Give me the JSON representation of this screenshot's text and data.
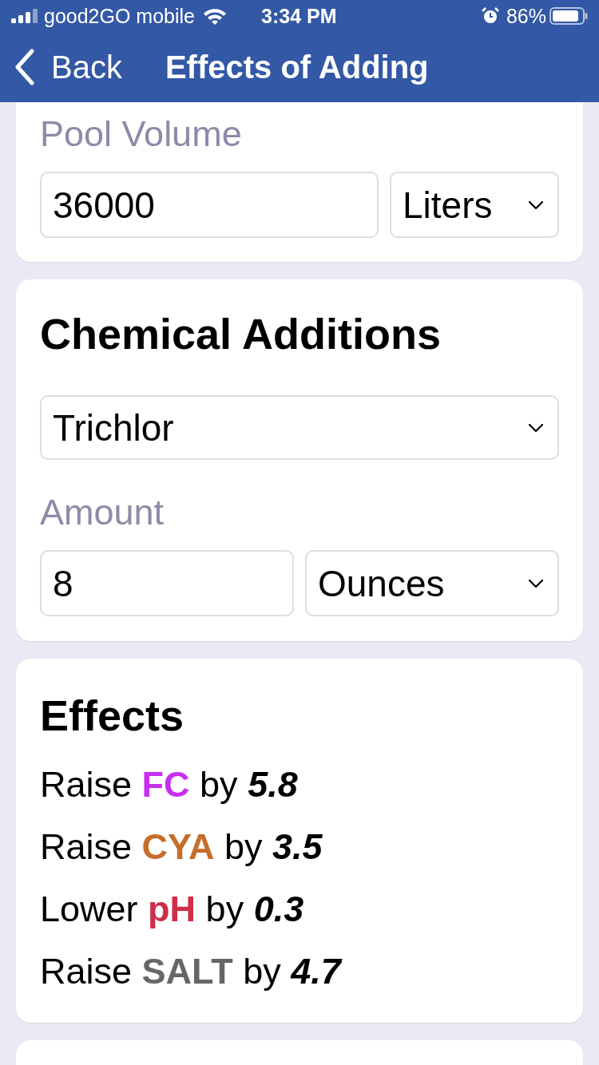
{
  "status_bar": {
    "carrier": "good2GO mobile",
    "time": "3:34 PM",
    "battery": "86%"
  },
  "nav_bar": {
    "back": "Back",
    "title": "Effects of Adding"
  },
  "pool_volume": {
    "label": "Pool Volume",
    "value": "36000",
    "unit": "Liters"
  },
  "chemical_additions": {
    "heading": "Chemical Additions",
    "chemical": "Trichlor",
    "amount_label": "Amount",
    "amount": "8",
    "amount_unit": "Ounces"
  },
  "effects": {
    "heading": "Effects",
    "items": [
      {
        "verb": "Raise",
        "parameter": "FC",
        "color": "#c72ff0",
        "connector": "by",
        "amount": "5.8"
      },
      {
        "verb": "Raise",
        "parameter": "CYA",
        "color": "#c76d2b",
        "connector": "by",
        "amount": "3.5"
      },
      {
        "verb": "Lower",
        "parameter": "pH",
        "color": "#cf2d48",
        "connector": "by",
        "amount": "0.3"
      },
      {
        "verb": "Raise",
        "parameter": "SALT",
        "color": "#666666",
        "connector": "by",
        "amount": "4.7"
      }
    ]
  }
}
